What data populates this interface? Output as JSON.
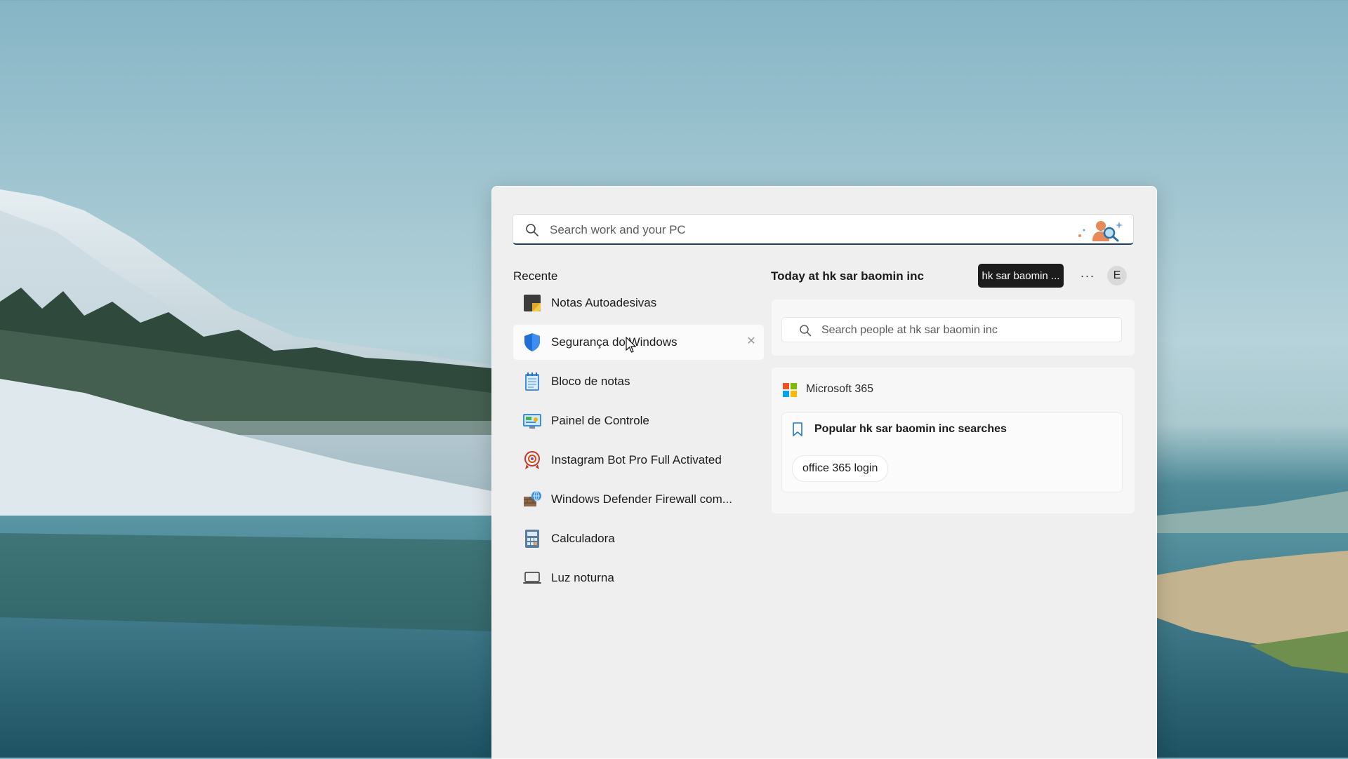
{
  "search": {
    "placeholder": "Search work and your PC"
  },
  "recent": {
    "title": "Recente",
    "items": [
      {
        "label": "Notas Autoadesivas",
        "icon": "sticky-notes-icon"
      },
      {
        "label": "Segurança do Windows",
        "icon": "windows-security-shield-icon"
      },
      {
        "label": "Bloco de notas",
        "icon": "notepad-icon"
      },
      {
        "label": "Painel de Controle",
        "icon": "control-panel-icon"
      },
      {
        "label": "Instagram Bot Pro Full Activated",
        "icon": "instagram-bot-icon"
      },
      {
        "label": "Windows Defender Firewall com...",
        "icon": "firewall-icon"
      },
      {
        "label": "Calculadora",
        "icon": "calculator-icon"
      },
      {
        "label": "Luz noturna",
        "icon": "laptop-icon"
      }
    ],
    "close_symbol": "✕"
  },
  "today": {
    "title": "Today at hk sar baomin inc",
    "org_pill": "hk sar baomin ...",
    "more_label": "···",
    "avatar_initial": "E"
  },
  "people": {
    "placeholder": "Search people at hk sar baomin inc"
  },
  "m365": {
    "title": "Microsoft 365",
    "popular_title": "Popular hk sar baomin inc searches",
    "chips": [
      "office 365 login"
    ]
  },
  "colors": {
    "accent_underline": "#1f3f66",
    "panel_bg": "#efefef",
    "pill_bg": "#1c1c1c"
  }
}
